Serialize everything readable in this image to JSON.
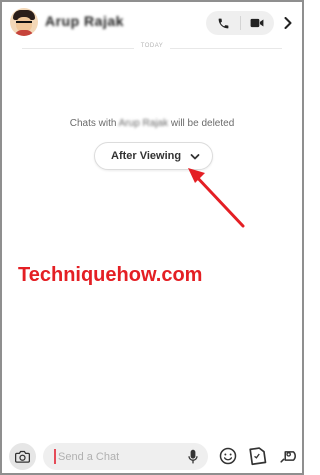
{
  "header": {
    "contact_name": "Arup Rajak",
    "avatar_alt": "Bitmoji avatar",
    "icons": {
      "phone": "phone-icon",
      "video": "video-camera-icon",
      "more": "chevron-right-icon"
    }
  },
  "conversation": {
    "date_label": "TODAY",
    "notice_prefix": "Chats with",
    "notice_name": "Arup Rajak",
    "notice_suffix": "will be deleted",
    "delete_option_label": "After Viewing"
  },
  "annotation": {
    "arrow_color": "#e41f24"
  },
  "watermark": {
    "text": "Techniquehow.com",
    "color": "#e41f24"
  },
  "composer": {
    "placeholder": "Send a Chat",
    "value": "",
    "icons": {
      "camera": "camera-icon",
      "mic": "microphone-icon",
      "emoji": "smiley-icon",
      "sticker": "sticker-icon",
      "games": "rocket-icon"
    },
    "caret_color": "#e54b58"
  }
}
